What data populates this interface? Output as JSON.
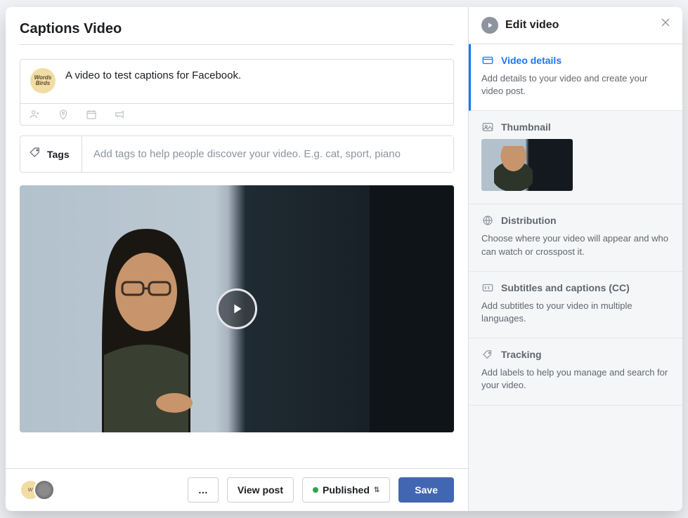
{
  "title": "Captions Video",
  "composer": {
    "avatar_label": "Words by Birds",
    "text": "A video to test captions for Facebook."
  },
  "tags": {
    "label": "Tags",
    "placeholder": "Add tags to help people discover your video. E.g. cat, sport, piano"
  },
  "bottom": {
    "more": "…",
    "view_post": "View post",
    "published": "Published",
    "save": "Save"
  },
  "sidebar": {
    "header": "Edit video",
    "sections": [
      {
        "title": "Video details",
        "desc": "Add details to your video and create your video post.",
        "active": true
      },
      {
        "title": "Thumbnail",
        "desc": null
      },
      {
        "title": "Distribution",
        "desc": "Choose where your video will appear and who can watch or crosspost it."
      },
      {
        "title": "Subtitles and captions (CC)",
        "desc": "Add subtitles to your video in multiple languages."
      },
      {
        "title": "Tracking",
        "desc": "Add labels to help you manage and search for your video."
      }
    ]
  }
}
